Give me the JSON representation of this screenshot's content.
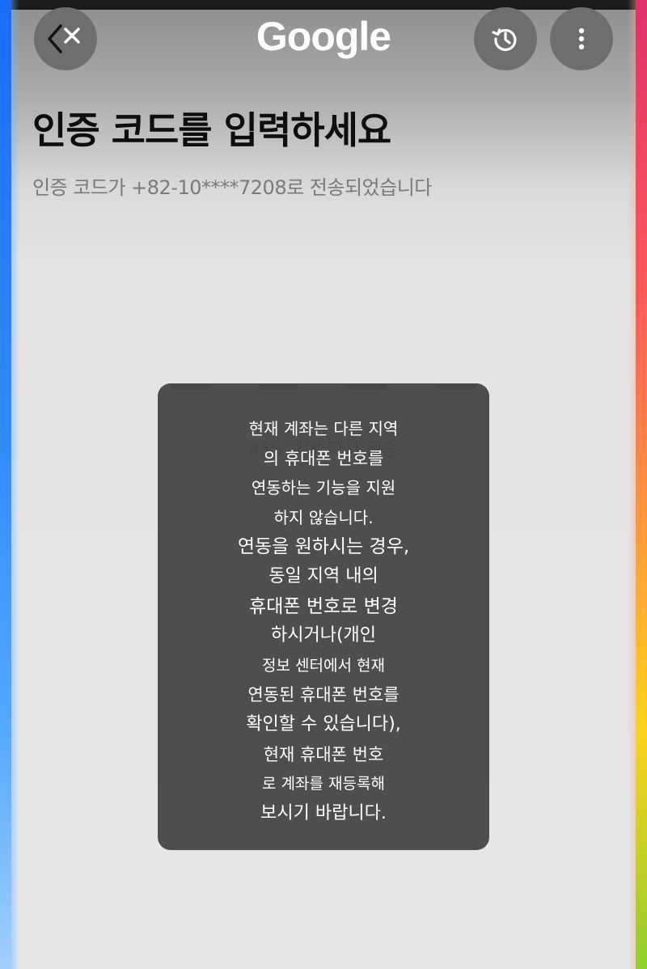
{
  "header": {
    "logo_text": "Google",
    "close_icon": "back-close-icon",
    "history_icon": "history-icon",
    "more_icon": "more-vertical-icon"
  },
  "main": {
    "title": "인증 코드를 입력하세요",
    "subtitle": "인증 코드가 +82-10****7208로 전송되었습니다",
    "timer_text": "45S 후에 다시 전송"
  },
  "toast": {
    "lines": [
      "현재 계좌는 다른 지역",
      "의 휴대폰 번호를",
      "연동하는 기능을 지원",
      "하지 않습니다.",
      "연동을 원하시는 경우,",
      "동일 지역 내의",
      "휴대폰 번호로 변경",
      "하시거나(개인",
      "정보 센터에서 현재",
      "연동된 휴대폰 번호를",
      "확인할 수 있습니다),",
      "현재 휴대폰 번호",
      "로 계좌를 재등록해",
      "보시기 바랍니다."
    ]
  },
  "colors": {
    "toast_bg": "#484848",
    "title": "#0e0e0e",
    "subtitle": "#7a7a7a"
  }
}
